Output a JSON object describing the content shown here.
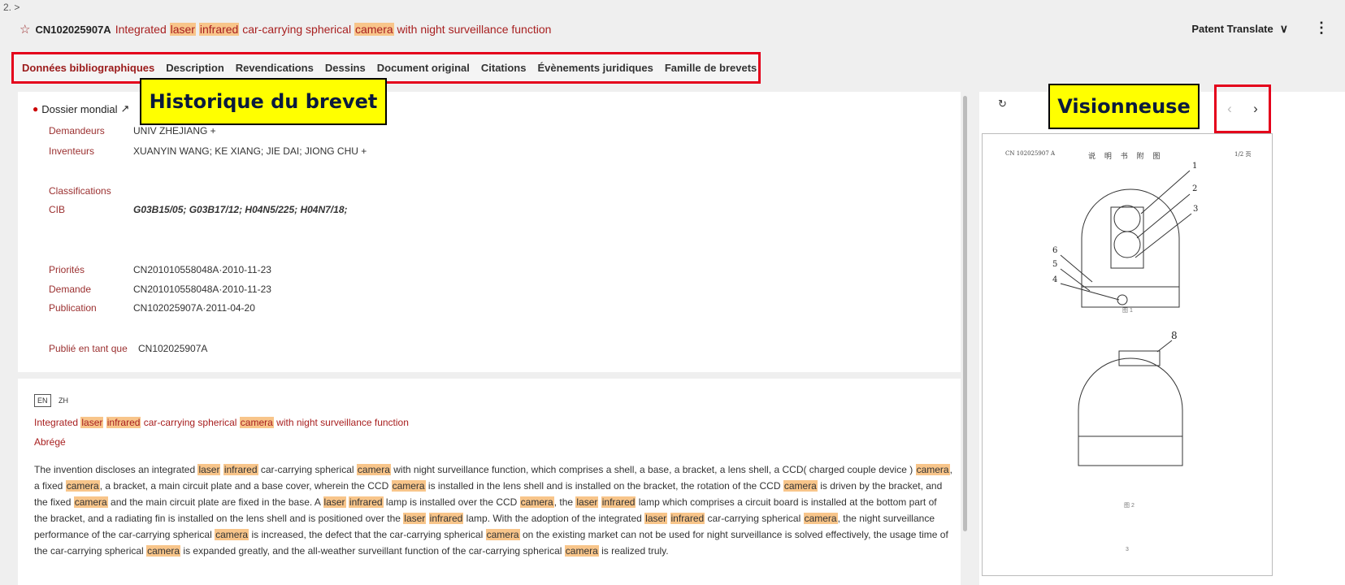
{
  "breadcrumb": "2. >",
  "header": {
    "publication_number": "CN102025907A",
    "title_parts": [
      {
        "t": "Integrated ",
        "hl": false
      },
      {
        "t": "laser",
        "hl": true
      },
      {
        "t": " ",
        "hl": false
      },
      {
        "t": "infrared",
        "hl": true
      },
      {
        "t": " car-carrying spherical ",
        "hl": false
      },
      {
        "t": "camera",
        "hl": true
      },
      {
        "t": " with night surveillance function",
        "hl": false
      }
    ],
    "translate_label": "Patent Translate",
    "more_icon": "kebab-icon"
  },
  "tabs": [
    {
      "label": "Données bibliographiques",
      "active": true
    },
    {
      "label": "Description",
      "active": false
    },
    {
      "label": "Revendications",
      "active": false
    },
    {
      "label": "Dessins",
      "active": false
    },
    {
      "label": "Document original",
      "active": false
    },
    {
      "label": "Citations",
      "active": false
    },
    {
      "label": "Évènements juridiques",
      "active": false
    },
    {
      "label": "Famille de brevets",
      "active": false
    }
  ],
  "annotations": {
    "history": "Historique du brevet",
    "viewer": "Visionneuse"
  },
  "biblio": {
    "dossier_label": "Dossier mondial",
    "applicants_label": "Demandeurs",
    "applicants_value": "UNIV ZHEJIANG  +",
    "inventors_label": "Inventeurs",
    "inventors_value": "XUANYIN WANG; KE XIANG; JIE DAI; JIONG CHU  +",
    "classifications_label": "Classifications",
    "cib_label": "CIB",
    "cib_value": "G03B15/05; G03B17/12; H04N5/225; H04N7/18;",
    "priorities_label": "Priorités",
    "priorities_value": "CN201010558048A·2010-11-23",
    "application_label": "Demande",
    "application_value": "CN201010558048A·2010-11-23",
    "publication_label": "Publication",
    "publication_value": "CN102025907A·2011-04-20",
    "published_as_label": "Publié en tant que",
    "published_as_value": "CN102025907A"
  },
  "abstract": {
    "lang_en": "EN",
    "lang_zh": "ZH",
    "title_parts": [
      {
        "t": "Integrated ",
        "hl": false
      },
      {
        "t": "laser",
        "hl": true
      },
      {
        "t": " ",
        "hl": false
      },
      {
        "t": "infrared",
        "hl": true
      },
      {
        "t": " car-carrying spherical ",
        "hl": false
      },
      {
        "t": "camera",
        "hl": true
      },
      {
        "t": " with night surveillance function",
        "hl": false
      }
    ],
    "heading": "Abrégé",
    "body_parts": [
      {
        "t": "The invention discloses an integrated ",
        "hl": false
      },
      {
        "t": "laser",
        "hl": true
      },
      {
        "t": " ",
        "hl": false
      },
      {
        "t": "infrared",
        "hl": true
      },
      {
        "t": " car-carrying spherical ",
        "hl": false
      },
      {
        "t": "camera",
        "hl": true
      },
      {
        "t": " with night surveillance function, which comprises a shell, a base, a bracket, a lens shell, a CCD( charged couple device ) ",
        "hl": false
      },
      {
        "t": "camera",
        "hl": true
      },
      {
        "t": ", a fixed ",
        "hl": false
      },
      {
        "t": "camera",
        "hl": true
      },
      {
        "t": ", a bracket, a main circuit plate and a base cover, wherein the CCD ",
        "hl": false
      },
      {
        "t": "camera",
        "hl": true
      },
      {
        "t": " is installed in the lens shell and is installed on the bracket, the rotation of the CCD ",
        "hl": false
      },
      {
        "t": "camera",
        "hl": true
      },
      {
        "t": " is driven by the bracket, and the fixed ",
        "hl": false
      },
      {
        "t": "camera",
        "hl": true
      },
      {
        "t": " and the main circuit plate are fixed in the base. A ",
        "hl": false
      },
      {
        "t": "laser",
        "hl": true
      },
      {
        "t": " ",
        "hl": false
      },
      {
        "t": "infrared",
        "hl": true
      },
      {
        "t": " lamp is installed over the CCD ",
        "hl": false
      },
      {
        "t": "camera",
        "hl": true
      },
      {
        "t": ", the ",
        "hl": false
      },
      {
        "t": "laser",
        "hl": true
      },
      {
        "t": " ",
        "hl": false
      },
      {
        "t": "infrared",
        "hl": true
      },
      {
        "t": " lamp which comprises a circuit board is installed at the bottom part of the bracket, and a radiating fin is installed on the lens shell and is positioned over the ",
        "hl": false
      },
      {
        "t": "laser",
        "hl": true
      },
      {
        "t": " ",
        "hl": false
      },
      {
        "t": "infrared",
        "hl": true
      },
      {
        "t": " lamp. With the adoption of the integrated ",
        "hl": false
      },
      {
        "t": "laser",
        "hl": true
      },
      {
        "t": " ",
        "hl": false
      },
      {
        "t": "infrared",
        "hl": true
      },
      {
        "t": " car-carrying spherical ",
        "hl": false
      },
      {
        "t": "camera",
        "hl": true
      },
      {
        "t": ", the night surveillance performance of the car-carrying spherical ",
        "hl": false
      },
      {
        "t": "camera",
        "hl": true
      },
      {
        "t": " is increased, the defect that the car-carrying spherical ",
        "hl": false
      },
      {
        "t": "camera",
        "hl": true
      },
      {
        "t": " on the existing market can not be used for night surveillance is solved effectively, the usage time of the car-carrying spherical ",
        "hl": false
      },
      {
        "t": "camera",
        "hl": true
      },
      {
        "t": " is expanded greatly, and the all-weather surveillant function of the car-carrying spherical ",
        "hl": false
      },
      {
        "t": "camera",
        "hl": true
      },
      {
        "t": " is realized truly.",
        "hl": false
      }
    ]
  },
  "viewer": {
    "page_header_left": "CN 102025907 A",
    "page_header_center": "说 明 书 附 图",
    "page_header_right": "1/2 页",
    "fig1_caption": "图 1",
    "fig2_caption": "图 2",
    "page_footer": "3",
    "callouts": [
      "1",
      "2",
      "3",
      "6",
      "5",
      "4",
      "8"
    ]
  }
}
